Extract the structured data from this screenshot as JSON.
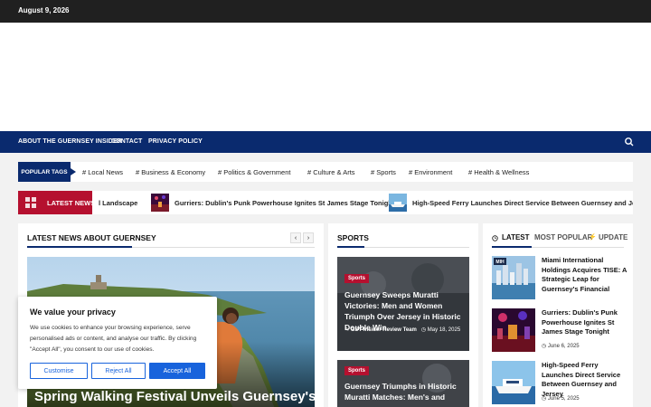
{
  "topbar": {
    "date": "August 9, 2026"
  },
  "nav": {
    "links": [
      "About The Guernsey Insider",
      "Contact",
      "Privacy Policy"
    ],
    "search_icon": "search-icon"
  },
  "tags": {
    "label": "Popular Tags",
    "items": [
      "# Local News",
      "# Business & Economy",
      "# Politics & Government",
      "# Culture & Arts",
      "# Sports",
      "# Environment",
      "# Health & Wellness"
    ]
  },
  "ticker": {
    "label": "Latest News",
    "items": [
      "l Landscape",
      "Gurriers: Dublin's Punk Powerhouse Ignites St James Stage Tonight",
      "High-Speed Ferry Launches Direct Service Between Guernsey and Jersey"
    ]
  },
  "main": {
    "title": "Latest News About Guernsey",
    "prev": "‹",
    "next": "›",
    "hero_title": "Spring Walking Festival Unveils Guernsey's"
  },
  "sports": {
    "title": "Sports",
    "cards": [
      {
        "category": "Sports",
        "title": "Guernsey Sweeps Muratti Victories: Men and Women Triumph Over Jersey in Historic Double Win",
        "author": "GSY Insider Review Team",
        "date": "May 18, 2025"
      },
      {
        "category": "Sports",
        "title": "Guernsey Triumphs in Historic Muratti Matches: Men's and"
      }
    ]
  },
  "sidebar": {
    "tabs": [
      "Latest",
      "Most Popular",
      "Update"
    ],
    "items": [
      {
        "title": "Miami International Holdings Acquires TISE: A Strategic Leap for Guernsey's Financial",
        "date": ""
      },
      {
        "title": "Gurriers: Dublin's Punk Powerhouse Ignites St James Stage Tonight",
        "date": "June 6, 2025"
      },
      {
        "title": "High-Speed Ferry Launches Direct Service Between Guernsey and Jersey",
        "date": "June 5, 2025"
      }
    ]
  },
  "cookie": {
    "title": "We value your privacy",
    "text": "We use cookies to enhance your browsing experience, serve personalised ads or content, and analyse our traffic. By clicking \"Accept All\", you consent to our use of cookies.",
    "customise": "Customise",
    "reject": "Reject All",
    "accept": "Accept All"
  },
  "colors": {
    "nav": "#0a2a6e",
    "accent_red": "#b5102f",
    "cookie_blue": "#1863dc"
  }
}
